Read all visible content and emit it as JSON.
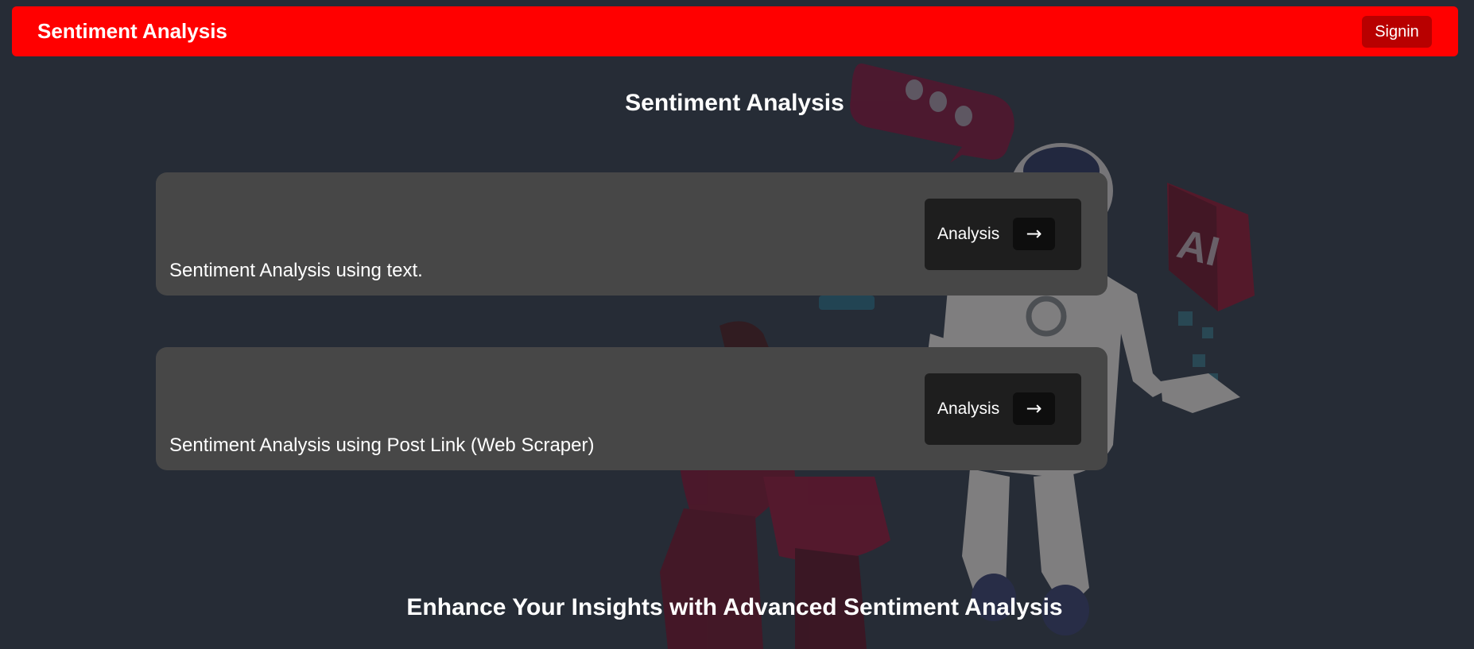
{
  "navbar": {
    "brand": "Sentiment Analysis",
    "signin_label": "Signin"
  },
  "main": {
    "title": "Sentiment Analysis",
    "cards": [
      {
        "text": "Sentiment Analysis using text.",
        "button_label": "Analysis",
        "button_icon": "arrow-right-icon",
        "arrow_glyph": "→"
      },
      {
        "text": "Sentiment Analysis using Post Link (Web Scraper)",
        "button_label": "Analysis",
        "button_icon": "arrow-right-icon",
        "arrow_glyph": "→"
      }
    ],
    "bottom_heading": "Enhance Your Insights with Advanced Sentiment Analysis"
  },
  "background": {
    "illustration_text": "AI"
  },
  "colors": {
    "page_background": "#262c36",
    "navbar": "#ff0000",
    "signin_button": "#b80000",
    "card": "#474747",
    "analysis_button": "#1e1e1e",
    "arrow_box": "#0e0e0e",
    "text": "#ffffff"
  }
}
